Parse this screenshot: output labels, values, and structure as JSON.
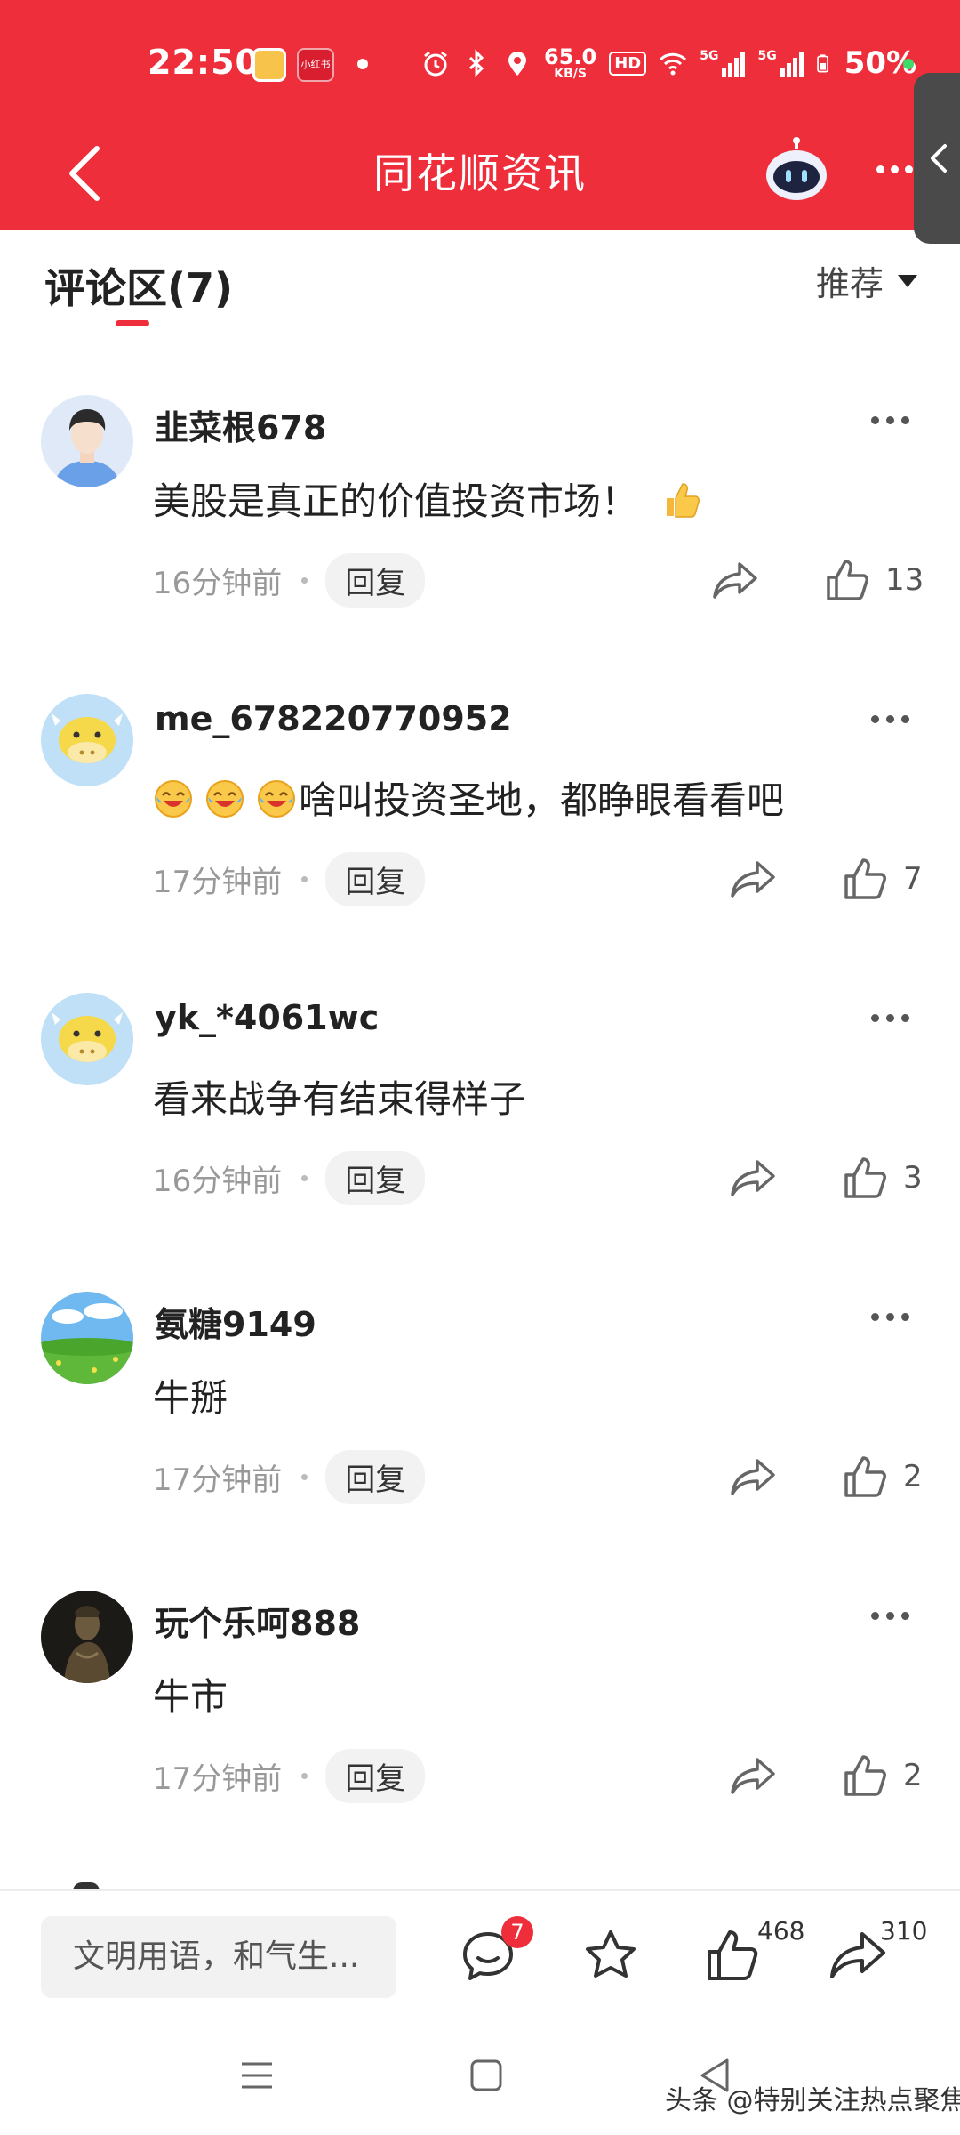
{
  "status_bar": {
    "time": "22:50",
    "app_icon_2_text": "小红书",
    "network_speed_value": "65.0",
    "network_speed_unit": "KB/S",
    "hd_label": "HD",
    "signal_1_label": "5G",
    "signal_2_label": "5G",
    "battery_percent": "50%"
  },
  "title_bar": {
    "title": "同花顺资讯",
    "back_icon": "chevron-left-icon",
    "robot_icon": "robot-assistant-icon",
    "more_icon": "more-dots-icon",
    "side_tab_icon": "chevron-left-icon"
  },
  "section": {
    "title": "评论区(7)",
    "sort_label": "推荐"
  },
  "comments": [
    {
      "username": "韭菜根678",
      "text": "美股是真正的价值投资市场！",
      "time": "16分钟前",
      "reply_label": "回复",
      "likes": "13",
      "avatar": "man-avatar"
    },
    {
      "username": "me_678220770952",
      "text": "啥叫投资圣地，都睁眼看看吧",
      "time": "17分钟前",
      "reply_label": "回复",
      "likes": "7",
      "avatar": "cow-avatar"
    },
    {
      "username": "yk_*4061wc",
      "text": "看来战争有结束得样子",
      "time": "16分钟前",
      "reply_label": "回复",
      "likes": "3",
      "avatar": "cow-avatar"
    },
    {
      "username": "氨糖9149",
      "text": "牛掰",
      "time": "17分钟前",
      "reply_label": "回复",
      "likes": "2",
      "avatar": "landscape-avatar"
    },
    {
      "username": "玩个乐呵888",
      "text": "牛市",
      "time": "17分钟前",
      "reply_label": "回复",
      "likes": "2",
      "avatar": "statue-avatar"
    }
  ],
  "bottom_bar": {
    "input_placeholder": "文明用语，和气生...",
    "comment_badge": "7",
    "like_count": "468",
    "share_count": "310"
  },
  "watermark": "头条 @特别关注热点聚焦",
  "colors": {
    "brand_red": "#ee2e3a",
    "muted_text": "#999999",
    "badge_red": "#ee2e3a"
  }
}
